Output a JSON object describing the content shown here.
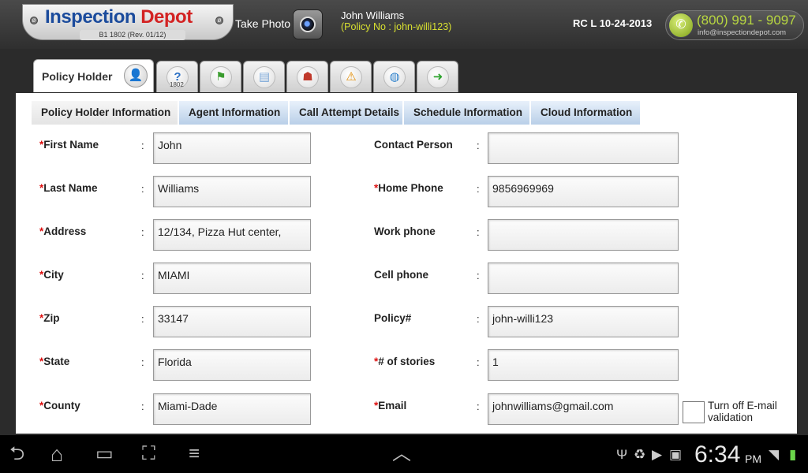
{
  "header": {
    "brand_part1": "Inspection",
    "brand_part2": "Depot",
    "brand_sub": "B1 1802 (Rev. 01/12)",
    "take_photo_label": "Take Photo",
    "user_name": "John Williams",
    "user_policy": "(Policy No : john-willi123)",
    "rc_label": "RC L 10-24-2013",
    "phone_number": "(800) 991 - 9097",
    "phone_email": "info@inspectiondepot.com",
    "brand_colors": {
      "blue": "#1b4b9c",
      "red": "#d32222",
      "accent_green": "#b7d640"
    }
  },
  "main_tabs": {
    "active_label": "Policy Holder",
    "icons": [
      {
        "name": "help-1802-icon",
        "glyph": "?"
      },
      {
        "name": "wind-icon",
        "glyph": "⚑"
      },
      {
        "name": "comments-icon",
        "glyph": "▤"
      },
      {
        "name": "people-icon",
        "glyph": "☗"
      },
      {
        "name": "warning-icon",
        "glyph": "⚠"
      },
      {
        "name": "globe-icon",
        "glyph": "◍"
      },
      {
        "name": "forward-arrow-icon",
        "glyph": "➜"
      }
    ],
    "help_sub": "1802"
  },
  "sub_tabs": [
    {
      "label": "Policy Holder Information",
      "active": true
    },
    {
      "label": "Agent Information",
      "active": false
    },
    {
      "label": "Call Attempt Details",
      "active": false
    },
    {
      "label": "Schedule Information",
      "active": false
    },
    {
      "label": "Cloud Information",
      "active": false
    }
  ],
  "form": {
    "left": [
      {
        "label": "First Name",
        "required": true,
        "value": "John"
      },
      {
        "label": "Last Name",
        "required": true,
        "value": "Williams"
      },
      {
        "label": "Address",
        "required": true,
        "value": "12/134, Pizza Hut center,"
      },
      {
        "label": "City",
        "required": true,
        "value": "MIAMI"
      },
      {
        "label": "Zip",
        "required": true,
        "value": "33147"
      },
      {
        "label": "State",
        "required": true,
        "value": "Florida"
      },
      {
        "label": "County",
        "required": true,
        "value": "Miami-Dade"
      }
    ],
    "right": [
      {
        "label": "Contact Person",
        "required": false,
        "value": ""
      },
      {
        "label": "Home Phone",
        "required": true,
        "value": "9856969969"
      },
      {
        "label": "Work phone",
        "required": false,
        "value": ""
      },
      {
        "label": "Cell phone",
        "required": false,
        "value": ""
      },
      {
        "label": "Policy#",
        "required": false,
        "value": "john-willi123"
      },
      {
        "label": "# of stories",
        "required": true,
        "value": "1"
      },
      {
        "label": "Email",
        "required": true,
        "value": "johnwilliams@gmail.com"
      }
    ],
    "email_validation_label": "Turn off E-mail validation",
    "email_validation_checked": false,
    "required_marker": "*",
    "colon": ":"
  },
  "status_bar": {
    "time": "6:34",
    "ampm": "PM",
    "nav_icons": [
      "back-icon",
      "home-icon",
      "recent-apps-icon",
      "screenshot-icon",
      "menu-icon",
      "up-chevron-icon"
    ],
    "status_icons": [
      "usb-icon",
      "recycle-icon",
      "play-store-icon",
      "media-icon",
      "wifi-icon",
      "battery-icon"
    ]
  }
}
